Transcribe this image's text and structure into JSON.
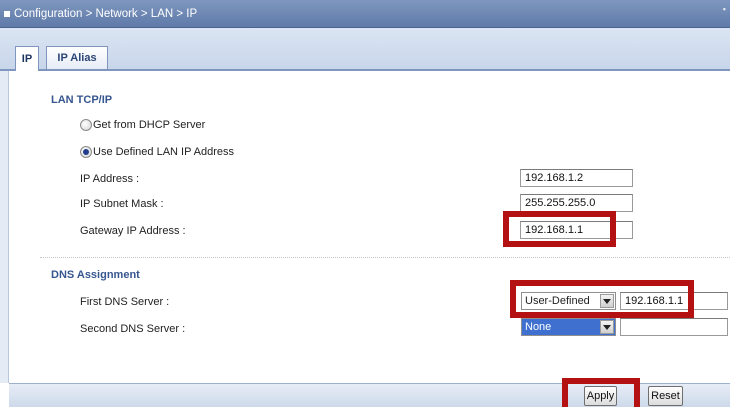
{
  "breadcrumb": "Configuration > Network > LAN > IP",
  "tabs": [
    {
      "label": "IP",
      "active": true
    },
    {
      "label": "IP Alias",
      "active": false
    }
  ],
  "lan_tcpip": {
    "title": "LAN TCP/IP",
    "radio_dhcp": "Get from DHCP Server",
    "radio_defined": "Use Defined LAN IP Address",
    "selected_option": "Use Defined LAN IP Address",
    "ip_address_label": "IP Address :",
    "ip_address": "192.168.1.2",
    "subnet_mask_label": "IP Subnet Mask :",
    "subnet_mask": "255.255.255.0",
    "gateway_label": "Gateway IP Address :",
    "gateway": "192.168.1.1"
  },
  "dns": {
    "title": "DNS Assignment",
    "first_label": "First DNS Server :",
    "first_type": "User-Defined",
    "first_value": "192.168.1.1",
    "second_label": "Second DNS Server :",
    "second_type": "None",
    "second_value": ""
  },
  "buttons": {
    "apply": "Apply",
    "reset": "Reset"
  },
  "colors": {
    "highlight_box": "#b41212",
    "title_bar": "#6f88b5",
    "section_title": "#36568f"
  }
}
